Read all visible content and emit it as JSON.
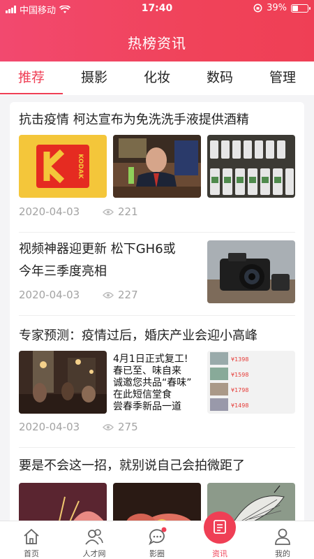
{
  "status": {
    "carrier": "中国移动",
    "time": "17:40",
    "battery": "39%"
  },
  "header": {
    "title": "热榜资讯"
  },
  "tabs": [
    {
      "label": "推荐"
    },
    {
      "label": "摄影"
    },
    {
      "label": "化妆"
    },
    {
      "label": "数码"
    },
    {
      "label": "管理"
    }
  ],
  "articles": [
    {
      "title": "抗击疫情 柯达宣布为免洗洗手液提供酒精",
      "date": "2020-04-03",
      "views": "221",
      "thumb_kodak_text": "KODAK"
    },
    {
      "title_line1": "视频神器迎更新 松下GH6或",
      "title_line2": "今年三季度亮相",
      "date": "2020-04-03",
      "views": "227"
    },
    {
      "title": "专家预测：疫情过后，婚庆产业会迎小高峰",
      "date": "2020-04-03",
      "views": "275",
      "poster_lines": [
        "4月1日正式复工!",
        "春已至、味自来",
        "诚邀您共品“春味”",
        "在此短信堂食",
        "尝春季新品一道"
      ],
      "list_prices": [
        "¥1398",
        "¥1598",
        "¥1798",
        "¥1498"
      ]
    },
    {
      "title": "要是不会这一招，就别说自己会拍微距了"
    }
  ],
  "tabbar": [
    {
      "label": "首页",
      "icon": "home-icon"
    },
    {
      "label": "人才网",
      "icon": "people-icon"
    },
    {
      "label": "影圈",
      "icon": "chat-icon"
    },
    {
      "label": "资讯",
      "icon": "news-icon"
    },
    {
      "label": "我的",
      "icon": "profile-icon"
    }
  ],
  "colors": {
    "accent": "#ef3f55",
    "text": "#222222",
    "meta": "#a3a3a3"
  }
}
